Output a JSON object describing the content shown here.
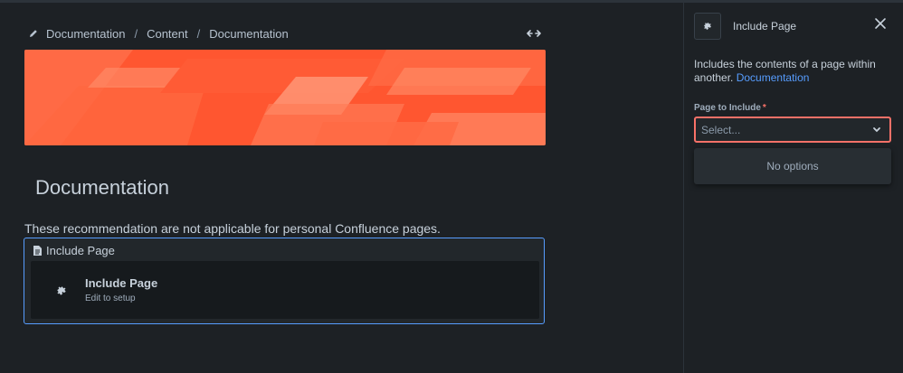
{
  "breadcrumb": {
    "items": [
      "Documentation",
      "Content",
      "Documentation"
    ],
    "separator": "/"
  },
  "page": {
    "title": "Documentation",
    "note": "These recommendation are not applicable for personal Confluence pages."
  },
  "macro": {
    "header_label": "Include Page",
    "title": "Include Page",
    "subtitle": "Edit to setup"
  },
  "panel": {
    "title": "Include Page",
    "description": "Includes the contents of a page within another.",
    "description_link": "Documentation",
    "field_label": "Page to Include",
    "required_marker": "*",
    "select_placeholder": "Select...",
    "dropdown_empty": "No options"
  },
  "colors": {
    "banner_primary": "#ff5630",
    "banner_light": "#ff7a52",
    "link": "#579dff",
    "error_border": "#f87168",
    "macro_border": "#579dff"
  },
  "icons": [
    "pencil-icon",
    "expand-width-icon",
    "page-icon",
    "puzzle-icon",
    "close-icon",
    "chevron-down-icon"
  ]
}
